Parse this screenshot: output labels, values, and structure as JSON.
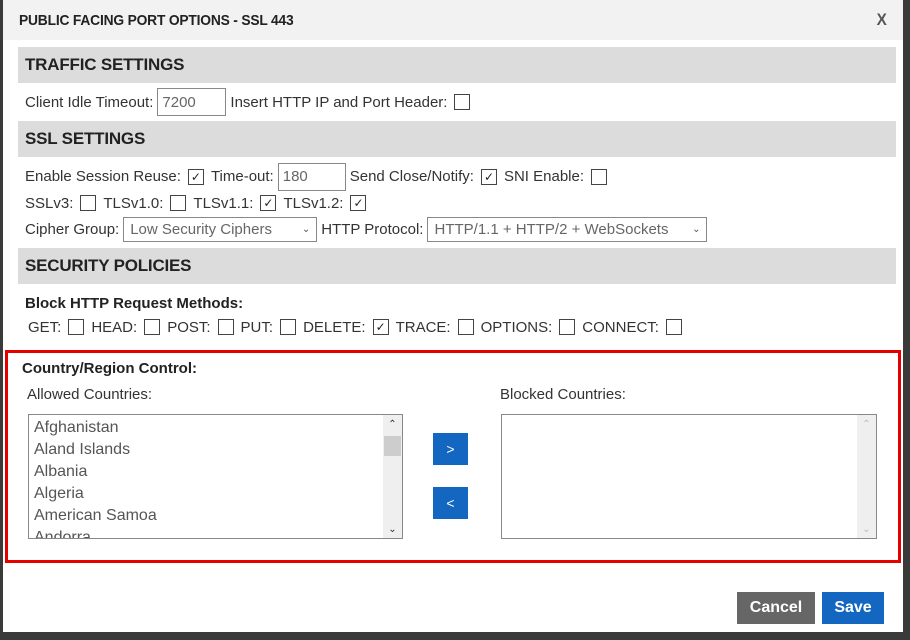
{
  "dialog": {
    "title": "PUBLIC FACING PORT OPTIONS - SSL 443",
    "close_label": "X"
  },
  "traffic": {
    "header": "TRAFFIC SETTINGS",
    "client_idle_timeout_label": "Client Idle Timeout:",
    "client_idle_timeout_value": "7200",
    "insert_header_label": "Insert HTTP IP and Port Header:",
    "insert_header_checked": false
  },
  "ssl": {
    "header": "SSL SETTINGS",
    "session_reuse_label": "Enable Session Reuse:",
    "session_reuse_checked": true,
    "timeout_label": "Time-out:",
    "timeout_value": "180",
    "send_close_label": "Send Close/Notify:",
    "send_close_checked": true,
    "sni_label": "SNI Enable:",
    "sni_checked": false,
    "protocols": [
      {
        "label": "SSLv3:",
        "checked": false
      },
      {
        "label": "TLSv1.0:",
        "checked": false
      },
      {
        "label": "TLSv1.1:",
        "checked": true
      },
      {
        "label": "TLSv1.2:",
        "checked": true
      }
    ],
    "cipher_group_label": "Cipher Group:",
    "cipher_group_value": "Low Security Ciphers",
    "http_protocol_label": "HTTP Protocol:",
    "http_protocol_value": "HTTP/1.1 + HTTP/2 + WebSockets"
  },
  "security": {
    "header": "SECURITY POLICIES",
    "block_methods_label": "Block HTTP Request Methods:",
    "methods": [
      {
        "label": "GET:",
        "checked": false
      },
      {
        "label": "HEAD:",
        "checked": false
      },
      {
        "label": "POST:",
        "checked": false
      },
      {
        "label": "PUT:",
        "checked": false
      },
      {
        "label": "DELETE:",
        "checked": true
      },
      {
        "label": "TRACE:",
        "checked": false
      },
      {
        "label": "OPTIONS:",
        "checked": false
      },
      {
        "label": "CONNECT:",
        "checked": false
      }
    ]
  },
  "country": {
    "title": "Country/Region Control:",
    "allowed_label": "Allowed Countries:",
    "blocked_label": "Blocked Countries:",
    "allowed": [
      "Afghanistan",
      "Aland Islands",
      "Albania",
      "Algeria",
      "American Samoa",
      "Andorra"
    ],
    "blocked": [],
    "add_label": ">",
    "remove_label": "<"
  },
  "footer": {
    "cancel_label": "Cancel",
    "save_label": "Save"
  },
  "colors": {
    "accent": "#1467c0",
    "highlight_border": "#e50000",
    "cancel": "#666666",
    "section_bg": "#dcdcdc"
  }
}
